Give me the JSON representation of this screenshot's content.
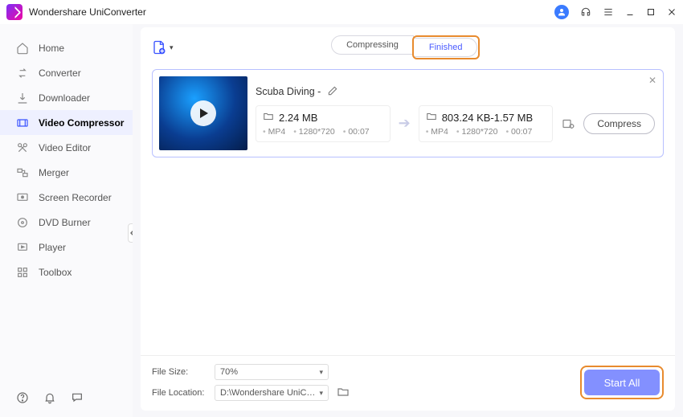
{
  "app": {
    "title": "Wondershare UniConverter"
  },
  "sidebar": {
    "items": [
      {
        "label": "Home"
      },
      {
        "label": "Converter"
      },
      {
        "label": "Downloader"
      },
      {
        "label": "Video Compressor"
      },
      {
        "label": "Video Editor"
      },
      {
        "label": "Merger"
      },
      {
        "label": "Screen Recorder"
      },
      {
        "label": "DVD Burner"
      },
      {
        "label": "Player"
      },
      {
        "label": "Toolbox"
      }
    ],
    "active_index": 3
  },
  "tabs": {
    "compressing": "Compressing",
    "finished": "Finished",
    "active": "finished"
  },
  "file": {
    "title": "Scuba Diving -",
    "src": {
      "size": "2.24 MB",
      "format": "MP4",
      "resolution": "1280*720",
      "duration": "00:07"
    },
    "dst": {
      "size": "803.24 KB-1.57 MB",
      "format": "MP4",
      "resolution": "1280*720",
      "duration": "00:07"
    }
  },
  "buttons": {
    "compress": "Compress",
    "start_all": "Start All"
  },
  "footer": {
    "file_size_label": "File Size:",
    "file_size_value": "70%",
    "file_location_label": "File Location:",
    "file_location_value": "D:\\Wondershare UniConverte"
  }
}
